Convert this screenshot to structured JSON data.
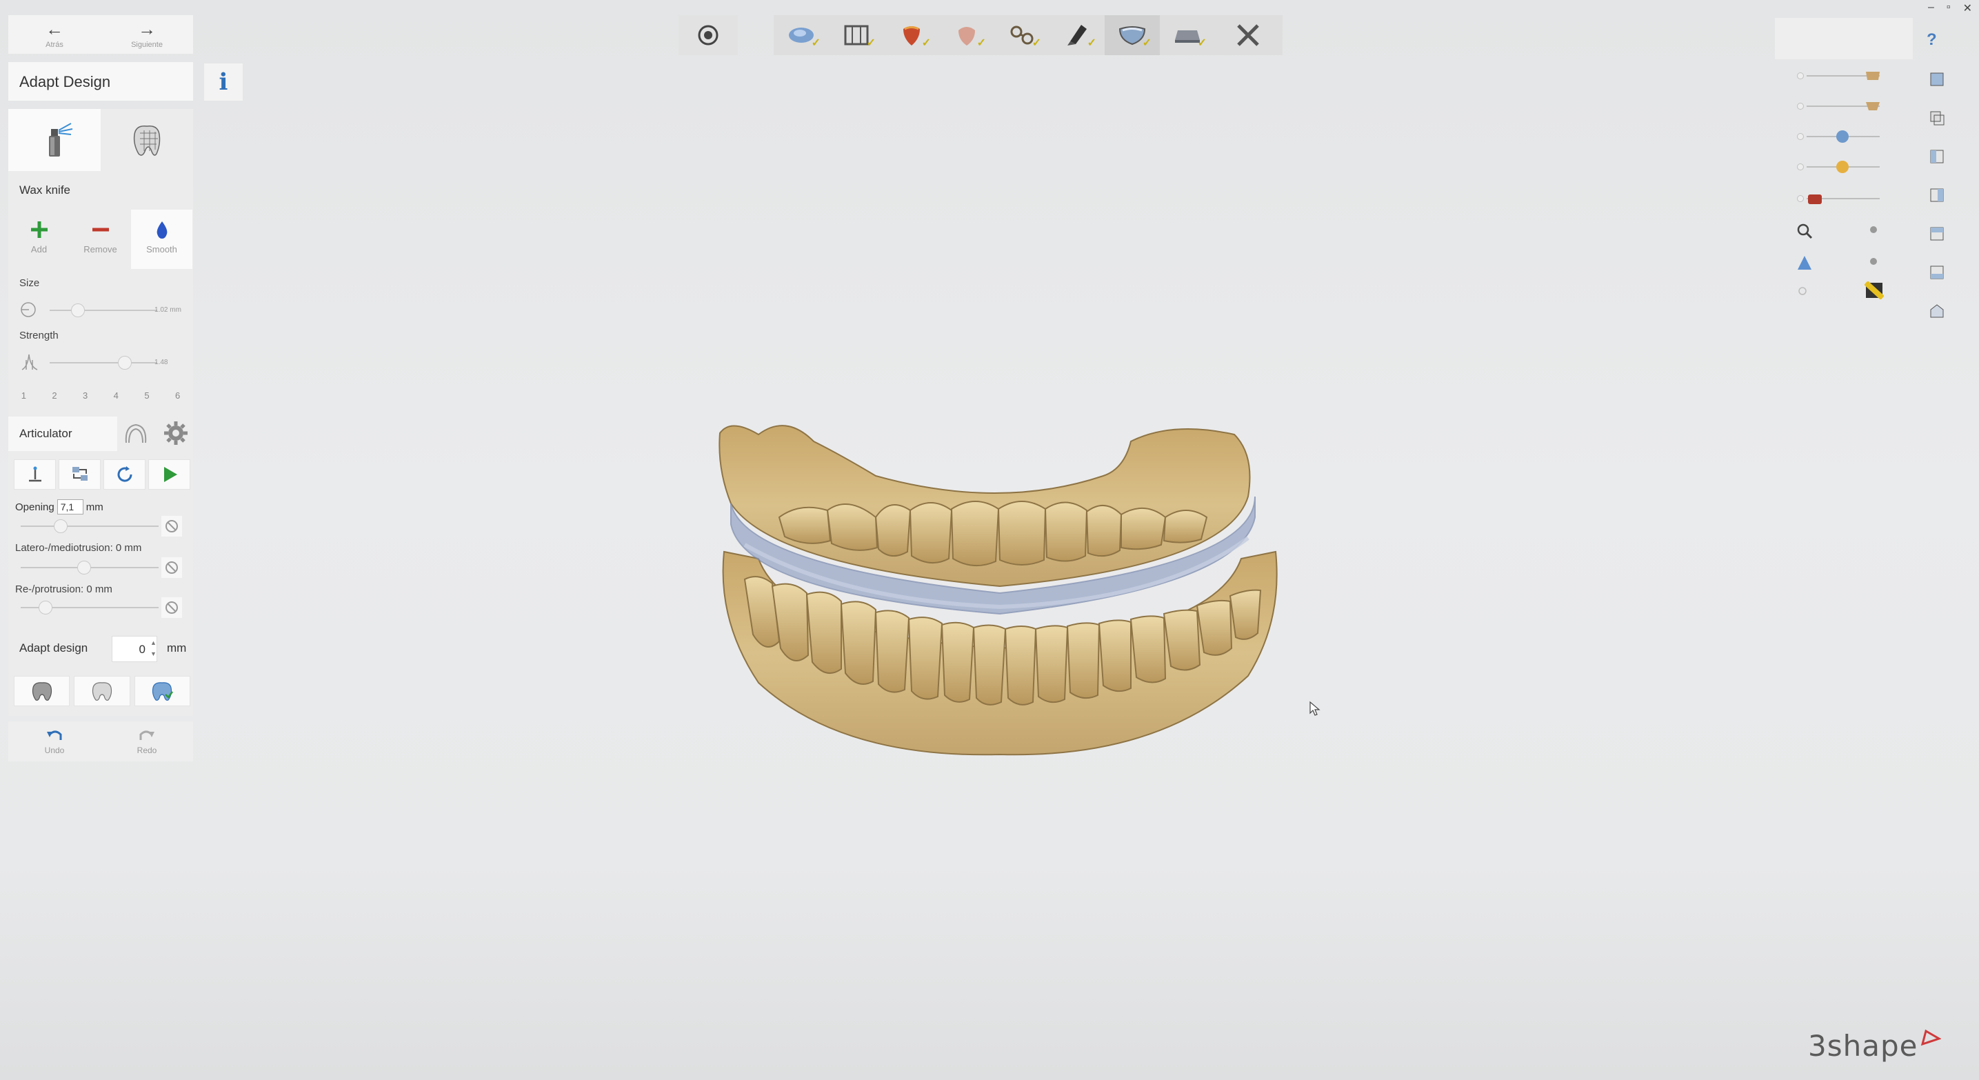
{
  "window": {
    "minimize": "–",
    "maximize": "▫",
    "close": "✕"
  },
  "nav": {
    "back_label": "Atrás",
    "next_label": "Siguiente"
  },
  "title": "Adapt Design",
  "info": "i",
  "section_wax": "Wax knife",
  "wax_tools": [
    {
      "label": "Add",
      "color": "#2e9a3a"
    },
    {
      "label": "Remove",
      "color": "#c0392b"
    },
    {
      "label": "Smooth",
      "color": "#2b56c6"
    }
  ],
  "size": {
    "label": "Size",
    "value": "1.02 mm",
    "position": 0.26
  },
  "strength": {
    "label": "Strength",
    "value": "1.48",
    "position": 0.7
  },
  "numbers": [
    "1",
    "2",
    "3",
    "4",
    "5",
    "6"
  ],
  "articulator": {
    "label": "Articulator",
    "opening_label": "Opening",
    "opening_value": "7,1",
    "opening_unit": "mm",
    "latero_label": "Latero-/mediotrusion: 0 mm",
    "protrusion_label": "Re-/protrusion: 0 mm"
  },
  "adapt": {
    "label": "Adapt design",
    "value": "0",
    "unit": "mm"
  },
  "undo": {
    "undo_label": "Undo",
    "redo_label": "Redo"
  },
  "toolbar_steps": [
    "scan",
    "margin",
    "crown",
    "coping",
    "connector",
    "tool",
    "adapt",
    "export"
  ],
  "brand": {
    "name": "3shape",
    "accent": "#d0393b"
  },
  "colors": {
    "model": "#d6bd86",
    "splint": "#9aa9c8",
    "accent_blue": "#2f6fb7"
  }
}
